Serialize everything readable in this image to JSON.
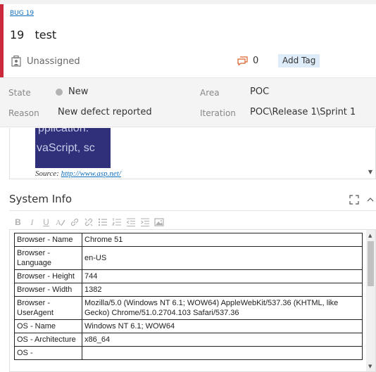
{
  "header": {
    "type_link": "BUG 19",
    "id": "19",
    "title": "test",
    "assigned": "Unassigned",
    "comment_count": "0",
    "add_tag": "Add Tag"
  },
  "fields": {
    "state_label": "State",
    "state_value": "New",
    "reason_label": "Reason",
    "reason_value": "New defect reported",
    "area_label": "Area",
    "area_value": "POC",
    "iteration_label": "Iteration",
    "iteration_value": "POC\\Release 1\\Sprint 1"
  },
  "description": {
    "image_line1": "pplication.",
    "image_line2": "vaScript, sc",
    "source_label": "Source:",
    "source_url": "http://www.asp.net/"
  },
  "system_info": {
    "title": "System Info",
    "rows": [
      {
        "key": "Browser - Name",
        "value": "Chrome 51"
      },
      {
        "key": "Browser - Language",
        "value": "en-US"
      },
      {
        "key": "Browser - Height",
        "value": "744"
      },
      {
        "key": "Browser - Width",
        "value": "1382"
      },
      {
        "key": "Browser - UserAgent",
        "value": "Mozilla/5.0 (Windows NT 6.1; WOW64) AppleWebKit/537.36 (KHTML, like Gecko) Chrome/51.0.2704.103 Safari/537.36"
      },
      {
        "key": "OS - Name",
        "value": "Windows NT 6.1; WOW64"
      },
      {
        "key": "OS - Architecture",
        "value": "x86_64"
      },
      {
        "key": "OS -",
        "value": ""
      }
    ]
  },
  "toolbar": {
    "bold": "B",
    "italic": "I",
    "underline": "U"
  },
  "colors": {
    "accent_red": "#cc293d",
    "link_blue": "#106ebe",
    "tag_bg": "#deecf9",
    "comment_orange": "#d9622b"
  }
}
